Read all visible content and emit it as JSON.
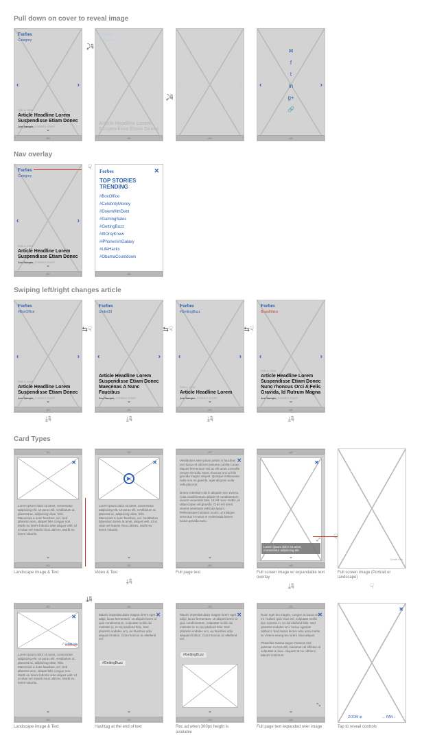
{
  "sections": {
    "pull_down": "Pull down on cover to reveal image",
    "nav_overlay": "Nav overlay",
    "swiping": "Swiping left/right changes article",
    "card_types": "Card Types"
  },
  "common": {
    "brand": "Forbes",
    "ad": "AD",
    "date": "FEB 4, 2015",
    "byline": "Jon Sample,",
    "byline_role": "FORBES STAFF",
    "category_default": "Category",
    "close_x": "✕"
  },
  "pulldown": {
    "screen2_label": "Sponsored",
    "headline1": "Article Headline Lorem Suspendisse Etiam Donec"
  },
  "share_icons": [
    "✉",
    "f",
    "t",
    "in",
    "g+",
    "🔗"
  ],
  "nav": {
    "top_stories": "TOP STORIES TRENDING",
    "items": [
      "#BoxOffice",
      "#CelebrityMoney",
      "#DownWithDebt",
      "#GamingSales",
      "#GettingBuzz",
      "#IfIOnlyKnew",
      "#iPhonesVsGalaxy",
      "#LifeHacks",
      "#ObamaCountdown"
    ]
  },
  "swipe": {
    "categories": [
      "#BoxOffice",
      "Under30",
      "#GettingBuzz",
      "BrandVoice"
    ],
    "headlines": [
      "Article Headline Lorem Suspendisse Etiam Donec",
      "Article Headline Lorem Suspendisse Etiam Donec Maecenas A Nunc Faucibus",
      "Article Headline Lorem",
      "Article Headline Lorem Suspendisse Etiam Donec Nunc rhoncus Orci A Felis Gravida, Id Rutrum Magna"
    ]
  },
  "cards": {
    "row1": {
      "captions": [
        "Landscape image & Text",
        "Video & Text",
        "Full page text",
        "Full screen image w/ expandable text overlay",
        "Full screen image (Portrait or landscape)"
      ],
      "lorem1": "Lorem ipsum dolor sit amet, consectetur adipiscing elit. Ut purus elit, vestibulum ut, placerat ac, adipiscing vitae, felis. Maecenas a nunc faucibus, vel. Sed pharetra sem, aliquet felis congue non. Morbi eu lorem lobortis ante aliquet velit. Id ut vitae vel mauris risus ultrices. Morbi eu lorem lobortis.",
      "lorem2": "Lorem ipsum dolor sit amet, consectetur adipiscing elit. Ut purus elit, vestibulum ut, placerat ac, adipiscing vitae, felis. Maecenas a nunc faucibus, vel. Vestibulum bibendum lorem at amet, aliquet velit. Id ut vitae vel mauris risus ultrices. Morbi eu lorem lobortis.",
      "vest": "Vestibulum ante ipsum primis in faucibus orci luctus et ultrices posuere cubilia Curae; Mauris fermentum nisl ac elit amet convallis ornare sit Nulla. Nunc rhoncus orci a felis gravida magna aliquet. Quisque malesuada nulla non mi gravida, eget aliquam nulla velit placerat.\n\nDonec interdum nisi in aliquam nec viverra. Cras condimentum aliquet et condimentum, viverra venenatis felis. Ut elit nunc mattis, et ullamcorper vel gravida. Cras est amet, viverra venenatis vehicula ipsum. Pellentesque habitant morbi. Ut tristique senectus et netus et malesuada fames luctus gravida nunc.",
      "overlay_text": "Lorem ipsum dolor sit amet, consectetur adipiscing elit."
    },
    "row2": {
      "captions": [
        "Landscape image & Text",
        "Hashtag at the end of text",
        "Rec ad when 300px height is available",
        "Full page text expanded over image",
        "Tap to reveal controls"
      ],
      "hashtag": "#GettingBuzz",
      "mauris": "Mauris imperdiet dolor magna lorem eget adipi, lacus fermentum. Ut aliquet lorem id quis condimentum, vulputate mollis dui molestie in. In nisl eleifend felis. Sed pharetra sodales orci, eu faucibus odio aliquam finibus. Cras rhoncus ac elleifend vel.",
      "nunc": "Nunc eget leo magna, congue ac lacus vel mi. Nullam quis risus vel, vulputate mollis dui molestie in. In nisl eleifend felis. Sed pharetra sodales orci, luctus egestas nibhorci. Sed metus lectus odio urna mattis et, viverra veung leo lorem risus aliquet.\n\nPhasellus massa augue rhoncus sed pulvinar. In eros elit, maximus vel efficitur at vulputate a risus. Aliquam at vic nibhorci. Mauris nonlorum.",
      "credit": "Credit Info",
      "zoom": "ZOOM",
      "pan": "PAN"
    }
  }
}
